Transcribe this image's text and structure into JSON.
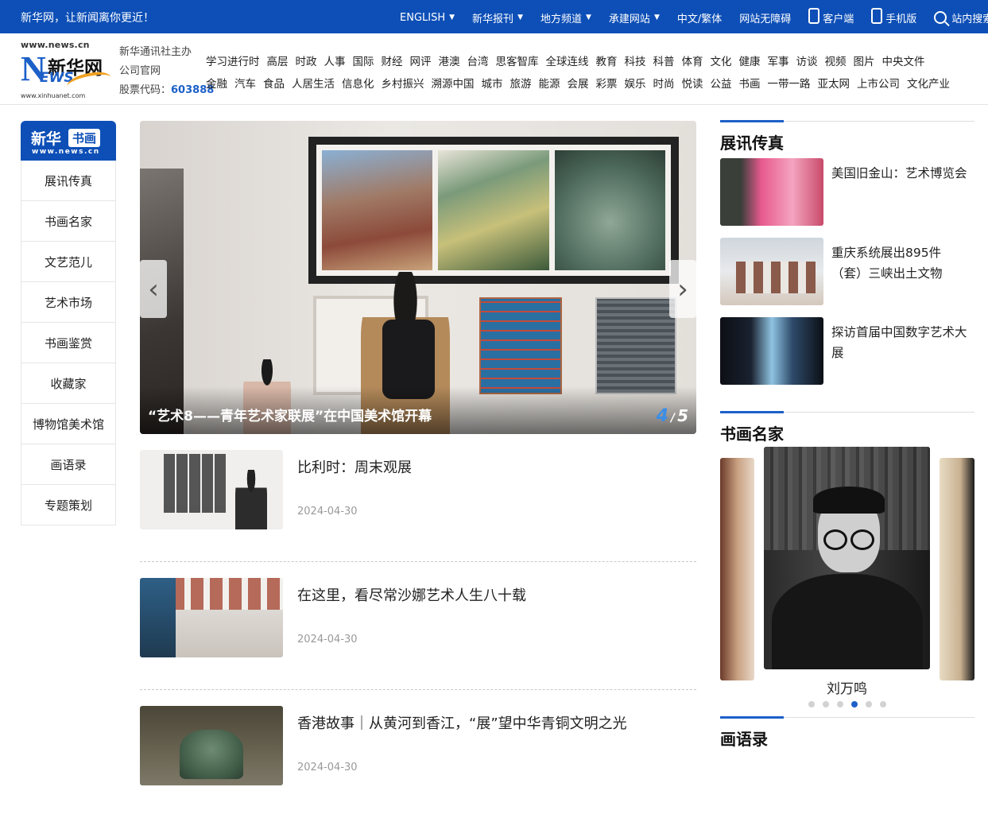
{
  "topbar": {
    "slogan": "新华网，让新闻离你更近！",
    "nav": [
      {
        "label": "ENGLISH",
        "dropdown": true
      },
      {
        "label": "新华报刊",
        "dropdown": true
      },
      {
        "label": "地方频道",
        "dropdown": true
      },
      {
        "label": "承建网站",
        "dropdown": true
      },
      {
        "label": "中文/繁体",
        "dropdown": false
      },
      {
        "label": "网站无障碍",
        "dropdown": false
      }
    ],
    "client_label": "客户端",
    "mobile_label": "手机版",
    "search_label": "站内搜索"
  },
  "logo": {
    "url_top": "www.news.cn",
    "name": "新华网",
    "news_n": "N",
    "news_rest": "EWS",
    "url_bottom": "www.xinhuanet.com"
  },
  "corp": {
    "line1": "新华通讯社主办",
    "line2": "公司官网",
    "stock_label": "股票代码：",
    "stock_code": "603888"
  },
  "channels": {
    "row1": [
      "学习进行时",
      "高层",
      "时政",
      "人事",
      "国际",
      "财经",
      "网评",
      "港澳",
      "台湾",
      "思客智库",
      "全球连线",
      "教育",
      "科技",
      "科普",
      "体育",
      "文化",
      "健康",
      "军事",
      "访谈",
      "视频",
      "图片",
      "中央文件"
    ],
    "row2": [
      "金融",
      "汽车",
      "食品",
      "人居生活",
      "信息化",
      "乡村振兴",
      "溯源中国",
      "城市",
      "旅游",
      "能源",
      "会展",
      "彩票",
      "娱乐",
      "时尚",
      "悦读",
      "公益",
      "书画",
      "一带一路",
      "亚太网",
      "上市公司",
      "文化产业"
    ]
  },
  "sidebar": {
    "logo_a": "新华",
    "logo_b": "书画",
    "logo_c": "www.news.cn",
    "items": [
      "展讯传真",
      "书画名家",
      "文艺范儿",
      "艺术市场",
      "书画鉴赏",
      "收藏家",
      "博物馆美术馆",
      "画语录",
      "专题策划"
    ]
  },
  "hero": {
    "caption": "“艺术8——青年艺术家联展”在中国美术馆开幕",
    "current": "4",
    "separator": "/",
    "total": "5"
  },
  "news": [
    {
      "title": "比利时：周末观展",
      "date": "2024-04-30"
    },
    {
      "title": "在这里，看尽常沙娜艺术人生八十载",
      "date": "2024-04-30"
    },
    {
      "title": "香港故事｜从黄河到香江，“展”望中华青铜文明之光",
      "date": "2024-04-30"
    }
  ],
  "right": {
    "section1": {
      "heading": "展讯传真",
      "items": [
        {
          "text": "美国旧金山：艺术博览会"
        },
        {
          "text": "重庆系统展出895件（套）三峡出土文物"
        },
        {
          "text": "探访首届中国数字艺术大展"
        }
      ]
    },
    "section2": {
      "heading": "书画名家",
      "name": "刘万鸣",
      "dots": 6,
      "active_dot": 4
    },
    "section3": {
      "heading": "画语录"
    }
  },
  "colors": {
    "brand_blue": "#0d4fb7",
    "accent_blue": "#1c60c8"
  }
}
